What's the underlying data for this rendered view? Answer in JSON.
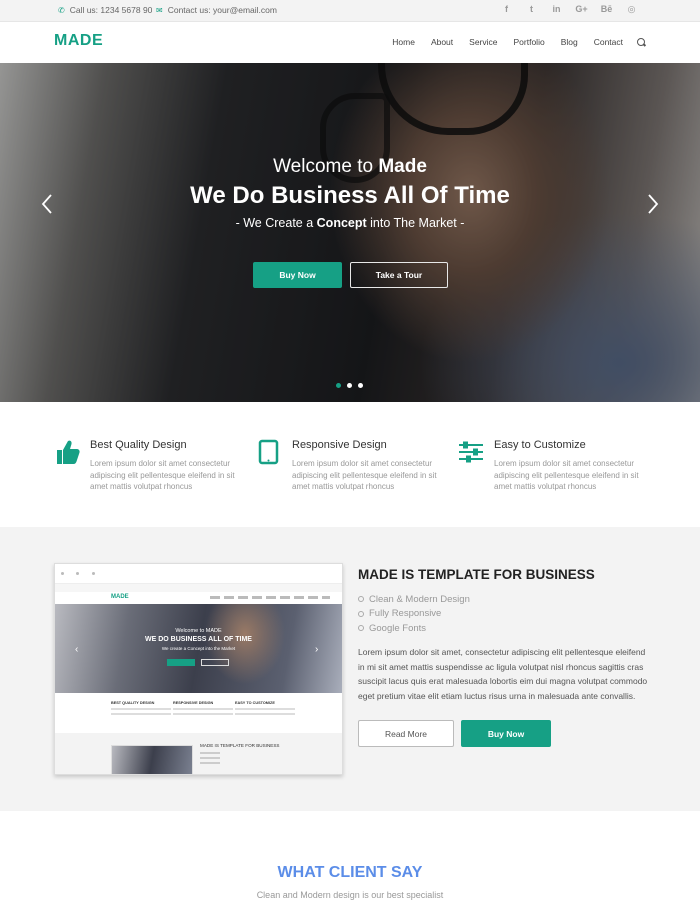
{
  "topbar": {
    "phone": "Call us: 1234 5678 90",
    "email": "Contact us: your@email.com",
    "socials": [
      "f",
      "t",
      "in",
      "G+",
      "Bē",
      "◎"
    ]
  },
  "header": {
    "logo": "MADE",
    "nav": [
      "Home",
      "About",
      "Service",
      "Portfolio",
      "Blog",
      "Contact"
    ]
  },
  "hero": {
    "welcome": "Welcome to",
    "welcome_bold": "Made",
    "headline": "We Do Business All Of Time",
    "tag_pre": "- We Create a",
    "tag_bold": "Concept",
    "tag_post": "into The Market -",
    "buy_label": "Buy Now",
    "tour_label": "Take a Tour",
    "active_slide": 1,
    "slide_count": 3
  },
  "features": [
    {
      "title": "Best Quality Design",
      "text": "Lorem ipsum dolor sit amet consectetur adipiscing elit pellentesque eleifend in sit amet mattis volutpat rhoncus",
      "icon": "thumbs-up-icon"
    },
    {
      "title": "Responsive Design",
      "text": "Lorem ipsum dolor sit amet consectetur adipiscing elit pellentesque eleifend in sit amet mattis volutpat rhoncus",
      "icon": "tablet-icon"
    },
    {
      "title": "Easy to Customize",
      "text": "Lorem ipsum dolor sit amet consectetur adipiscing elit pellentesque eleifend in sit amet mattis volutpat rhoncus",
      "icon": "sliders-icon"
    }
  ],
  "template": {
    "title": "MADE IS TEMPLATE FOR BUSINESS",
    "bullets": [
      "Clean & Modern Design",
      "Fully Responsive",
      "Google Fonts"
    ],
    "text": "Lorem ipsum dolor sit amet, consectetur adipiscing elit pellentesque eleifend in mi sit amet mattis suspendisse ac ligula volutpat nisl rhoncus sagittis cras suscipit lacus quis erat malesuada lobortis eim dui magna volutpat commodo eget pretium vitae elit etiam luctus risus urna in malesuada ante convallis.",
    "read_more": "Read More",
    "buy_now": "Buy Now",
    "mock": {
      "logo": "MADE",
      "welcome": "Welcome to MADE",
      "headline": "WE DO BUSINESS ALL OF TIME",
      "tag": "We create a Concept into the Market",
      "features": [
        "BEST QUALITY DESIGN",
        "RESPONSIVE DESIGN",
        "EASY TO CUSTOMIZE"
      ],
      "section_title": "MADE IS TEMPLATE FOR BUSINESS"
    }
  },
  "client": {
    "title": "WHAT CLIENT SAY",
    "subtitle": "Clean and Modern design is our best specialist"
  },
  "colors": {
    "accent": "#16a085",
    "client_title": "#5b8de8"
  }
}
